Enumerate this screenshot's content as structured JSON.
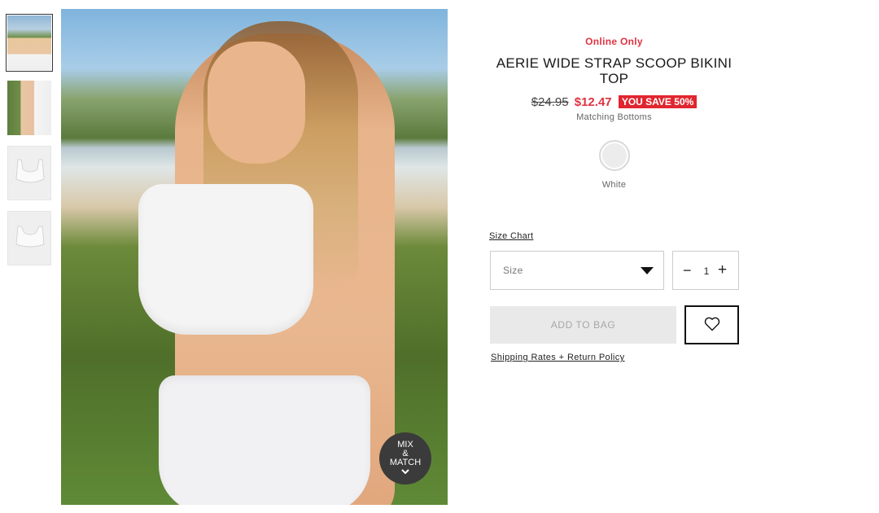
{
  "thumbnails": [
    {
      "icon": "model-photo-front",
      "active": true
    },
    {
      "icon": "model-photo-side",
      "active": false
    },
    {
      "icon": "product-flat-front",
      "active": false
    },
    {
      "icon": "product-flat-back",
      "active": false
    }
  ],
  "badge": {
    "line1": "MIX",
    "line2": "&",
    "line3": "MATCH"
  },
  "product": {
    "availability": "Online Only",
    "title": "AERIE WIDE STRAP SCOOP BIKINI TOP",
    "original_price": "$24.95",
    "sale_price": "$12.47",
    "savings": "YOU SAVE 50%",
    "matching_link": "Matching Bottoms",
    "color_name": "White",
    "swatch_color": "#ececec"
  },
  "size_chart_link": "Size Chart",
  "size_select": {
    "placeholder": "Size"
  },
  "quantity": {
    "minus": "−",
    "value": "1",
    "plus": "+"
  },
  "add_to_bag": "ADD TO BAG",
  "shipping_link": "Shipping Rates + Return Policy",
  "colors": {
    "accent_red": "#e03240",
    "save_badge_bg": "#e0262f",
    "disabled_button": "#e9e9e9"
  }
}
